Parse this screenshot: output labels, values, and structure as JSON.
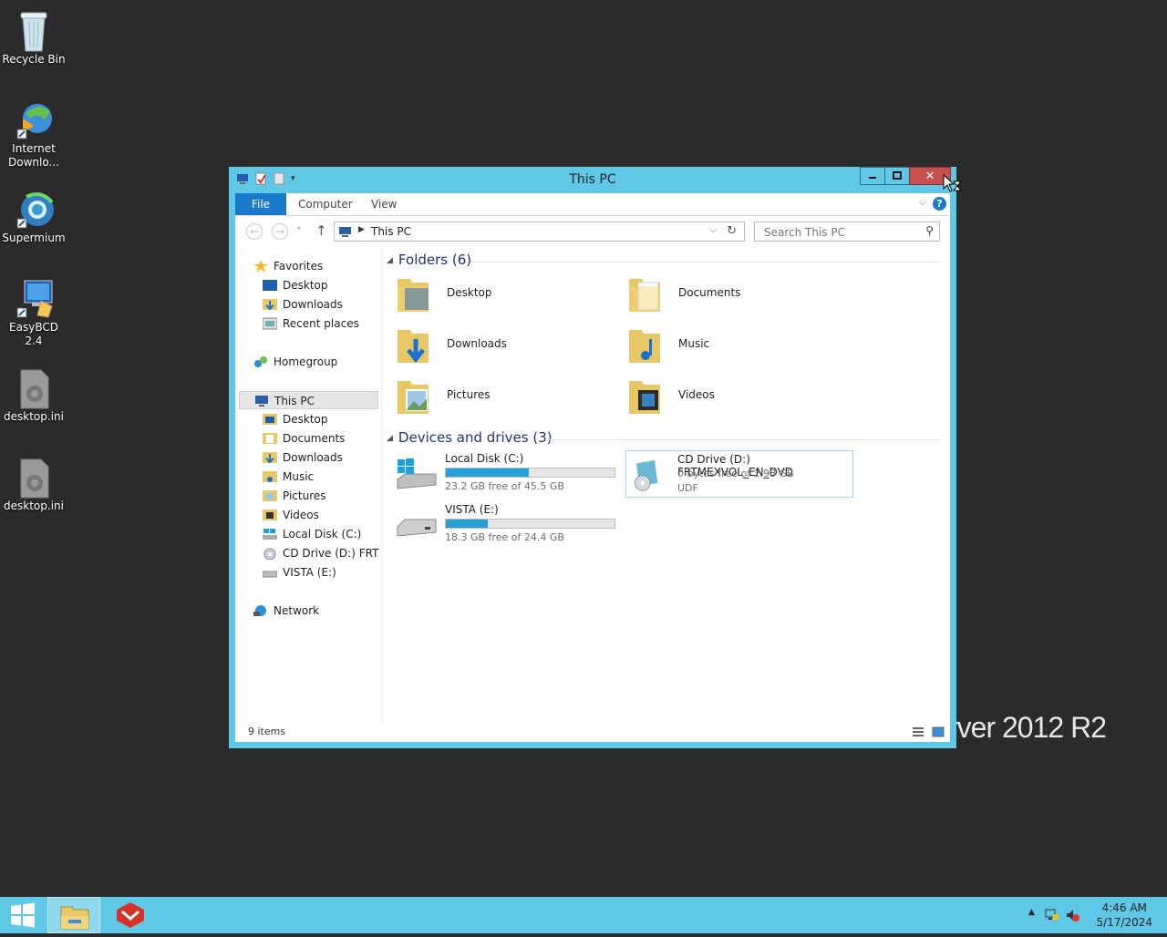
{
  "desktop": {
    "icons": [
      {
        "label": "Recycle Bin",
        "icon": "recycle-bin-icon"
      },
      {
        "label": "Internet Downlo...",
        "icon": "internet-download-manager-icon"
      },
      {
        "label": "Supermium",
        "icon": "supermium-browser-icon"
      },
      {
        "label": "EasyBCD 2.4",
        "icon": "easybcd-icon"
      },
      {
        "label": "desktop.ini",
        "icon": "settings-file-icon"
      },
      {
        "label": "desktop.ini",
        "icon": "settings-file-icon"
      }
    ],
    "watermark": "rver 2012 R2"
  },
  "window": {
    "title": "This PC",
    "controls": {
      "minimize": "minimize-icon",
      "maximize": "maximize-icon",
      "close": "✕"
    }
  },
  "ribbon": {
    "tabs": [
      "File",
      "Computer",
      "View"
    ],
    "help": "?"
  },
  "address": {
    "path": "This PC",
    "search_placeholder": "Search This PC"
  },
  "nav": {
    "favorites": {
      "label": "Favorites",
      "items": [
        "Desktop",
        "Downloads",
        "Recent places"
      ]
    },
    "homegroup": "Homegroup",
    "thispc": {
      "label": "This PC",
      "items": [
        "Desktop",
        "Documents",
        "Downloads",
        "Music",
        "Pictures",
        "Videos",
        "Local Disk (C:)",
        "CD Drive (D:) FRTMEXVOL_EN_DVD",
        "VISTA (E:)"
      ]
    },
    "network": "Network"
  },
  "content": {
    "folders_header": "Folders (6)",
    "folders": [
      "Desktop",
      "Documents",
      "Downloads",
      "Music",
      "Pictures",
      "Videos"
    ],
    "devices_header": "Devices and drives (3)",
    "drives": [
      {
        "name": "Local Disk (C:)",
        "free": "23.2 GB free of 45.5 GB",
        "used_fraction": 0.49
      },
      {
        "name": "CD Drive (D:) FRTMEXVOL_EN_DVD",
        "free": "0 bytes free of 2.98 GB",
        "fs": "UDF"
      },
      {
        "name": "VISTA (E:)",
        "free": "18.3 GB free of 24.4 GB",
        "used_fraction": 0.25
      }
    ]
  },
  "status": {
    "count": "9 items"
  },
  "taskbar": {
    "time": "4:46 AM",
    "date": "5/17/2024"
  },
  "colors": {
    "accent": "#5fc8e6",
    "file_tab": "#1979ca",
    "close": "#c7504f",
    "bar": "#26a0da"
  }
}
